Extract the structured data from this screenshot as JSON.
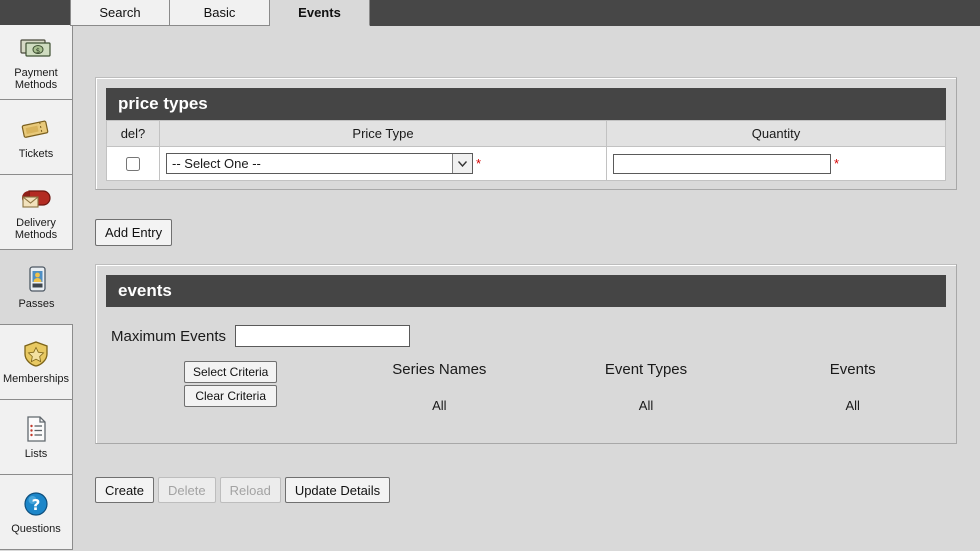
{
  "tabs": [
    {
      "label": "Search",
      "active": false
    },
    {
      "label": "Basic",
      "active": false
    },
    {
      "label": "Events",
      "active": true
    }
  ],
  "sidebar": {
    "items": [
      {
        "label": "Payment Methods",
        "icon": "money-icon"
      },
      {
        "label": "Tickets",
        "icon": "ticket-icon"
      },
      {
        "label": "Delivery Methods",
        "icon": "mailbox-icon"
      },
      {
        "label": "Passes",
        "icon": "pass-card-icon"
      },
      {
        "label": "Memberships",
        "icon": "shield-star-icon"
      },
      {
        "label": "Lists",
        "icon": "list-document-icon"
      },
      {
        "label": "Questions",
        "icon": "question-circle-icon"
      }
    ]
  },
  "price_types_panel": {
    "title": "price types",
    "columns": [
      "del?",
      "Price Type",
      "Quantity"
    ],
    "rows": [
      {
        "del_checked": false,
        "price_type_value": "-- Select One --",
        "price_type_required": "*",
        "quantity_value": "",
        "quantity_required": "*"
      }
    ]
  },
  "add_entry_button": "Add Entry",
  "events_panel": {
    "title": "events",
    "max_events_label": "Maximum Events",
    "max_events_value": "",
    "select_criteria_button": "Select Criteria",
    "clear_criteria_button": "Clear Criteria",
    "criteria_columns": [
      {
        "title": "Series Names",
        "value": "All"
      },
      {
        "title": "Event Types",
        "value": "All"
      },
      {
        "title": "Events",
        "value": "All"
      }
    ]
  },
  "bottom_buttons": [
    {
      "label": "Create",
      "disabled": false
    },
    {
      "label": "Delete",
      "disabled": true
    },
    {
      "label": "Reload",
      "disabled": true
    },
    {
      "label": "Update Details",
      "disabled": false
    }
  ],
  "colors": {
    "panel_header": "#454545",
    "page_background": "#d9d9d9",
    "required_marker": "#d40000",
    "tab_inactive": "#f1f1f1"
  }
}
